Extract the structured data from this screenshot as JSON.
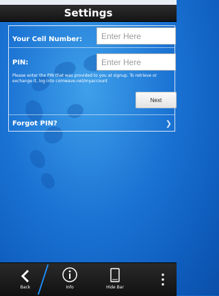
{
  "header": {
    "title": "Settings"
  },
  "form": {
    "cell_label": "Your Cell Number:",
    "cell_placeholder": "Enter Here",
    "pin_label": "PIN:",
    "pin_placeholder": "Enter Here",
    "note": "Please enter the PIN that was provided to you at signup. To retrieve or exchange it, log into comwave.net/myaccount",
    "next_label": "Next",
    "forgot_label": "Forgot PIN?"
  },
  "bottom_bar": {
    "back_label": "Back",
    "info_label": "Info",
    "hide_bar_label": "Hide Bar"
  },
  "icons": {
    "back": "chevron-left-icon",
    "info": "info-icon",
    "hide_bar": "phone-icon",
    "more": "more-vertical-icon",
    "forgot_chevron": "chevron-right-icon"
  },
  "colors": {
    "accent": "#1e8fff",
    "background": "#1b73d3",
    "bar": "#1a1a1a"
  }
}
